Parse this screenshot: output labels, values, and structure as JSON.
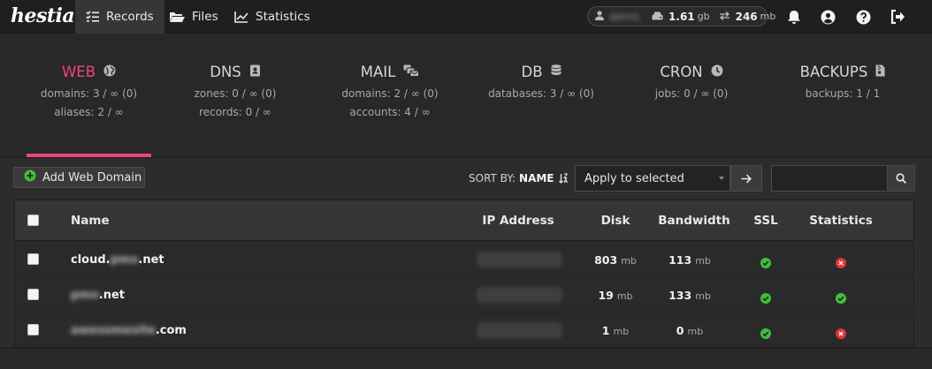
{
  "app": {
    "logo_text": "hestia"
  },
  "nav": {
    "tabs": [
      {
        "label": "Records",
        "icon": "list-check-icon"
      },
      {
        "label": "Files",
        "icon": "folder-icon"
      },
      {
        "label": "Statistics",
        "icon": "chart-line-icon"
      }
    ],
    "active_tab": "Records"
  },
  "user": {
    "username": "demo",
    "disk_value": "1.61",
    "disk_unit": "gb",
    "bandwidth_value": "246",
    "bandwidth_unit": "mb"
  },
  "stats": [
    {
      "title": "WEB",
      "icon": "globe-icon",
      "lines": [
        "domains: 3 / ∞ (0)",
        "aliases: 2 / ∞"
      ],
      "active": true
    },
    {
      "title": "DNS",
      "icon": "address-book-icon",
      "lines": [
        "zones: 0 / ∞ (0)",
        "records: 0 / ∞"
      ]
    },
    {
      "title": "MAIL",
      "icon": "mail-bulk-icon",
      "lines": [
        "domains: 2 / ∞ (0)",
        "accounts: 4 / ∞"
      ]
    },
    {
      "title": "DB",
      "icon": "database-icon",
      "lines": [
        "databases: 3 / ∞ (0)"
      ]
    },
    {
      "title": "CRON",
      "icon": "clock-icon",
      "lines": [
        "jobs: 0 / ∞ (0)"
      ]
    },
    {
      "title": "BACKUPS",
      "icon": "file-archive-icon",
      "lines": [
        "backups: 1 / 1"
      ]
    }
  ],
  "toolbar": {
    "add_button_label": "Add Web Domain",
    "sort_label": "SORT BY:",
    "sort_value": "NAME",
    "bulk_action_value": "Apply to selected",
    "search_placeholder": ""
  },
  "table": {
    "columns": [
      "Name",
      "IP Address",
      "Disk",
      "Bandwidth",
      "SSL",
      "Statistics"
    ],
    "rows": [
      {
        "name_prefix": "cloud.",
        "name_hidden": "pmo",
        "name_suffix": ".net",
        "disk": "803",
        "disk_unit": "mb",
        "bandwidth": "113",
        "bandwidth_unit": "mb",
        "ssl": true,
        "statistics": false
      },
      {
        "name_prefix": "",
        "name_hidden": "pmo",
        "name_suffix": ".net",
        "disk": "19",
        "disk_unit": "mb",
        "bandwidth": "133",
        "bandwidth_unit": "mb",
        "ssl": true,
        "statistics": true
      },
      {
        "name_prefix": "",
        "name_hidden": "awesomesite",
        "name_suffix": ".com",
        "disk": "1",
        "disk_unit": "mb",
        "bandwidth": "0",
        "bandwidth_unit": "mb",
        "ssl": true,
        "statistics": false
      }
    ]
  },
  "colors": {
    "accent": "#f0437a",
    "ok": "#3cc13b",
    "error": "#e23434"
  }
}
